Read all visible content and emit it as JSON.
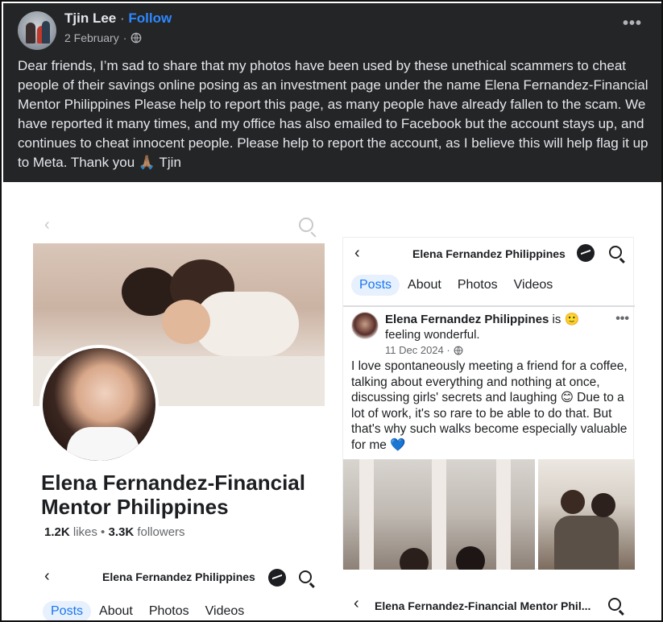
{
  "post": {
    "author": "Tjin Lee",
    "separator": "·",
    "follow_label": "Follow",
    "date": "2 February",
    "date_separator": "·",
    "audience_icon": "globe-icon",
    "more_label": "•••",
    "text": "Dear friends, I’m sad to share that my photos have been used by these unethical scammers to cheat people of their savings online posing as an investment page under the name Elena Fernandez-Financial Mentor Philippines  Please help to report this page, as many people have already fallen to the scam. We have reported it many times, and my office has also emailed to Facebook but the account stays up, and continues to cheat innocent people. Please help to report the account, as I believe this will help flag it up to Meta. Thank you 🙏🏽 Tjin"
  },
  "screenshot_left": {
    "page_name": "Elena Fernandez-Financial Mentor Philippines",
    "likes_count": "1.2K",
    "likes_label": "likes",
    "dot": "•",
    "followers_count": "3.3K",
    "followers_label": "followers"
  },
  "screenshot_bottom_left": {
    "title": "Elena Fernandez Philippines",
    "tabs": [
      "Posts",
      "About",
      "Photos",
      "Videos"
    ]
  },
  "screenshot_right": {
    "title": "Elena Fernandez Philippines",
    "tabs": [
      "Posts",
      "About",
      "Photos",
      "Videos"
    ],
    "post_author": "Elena Fernandez Philippines",
    "post_feeling": " is 🙂 feeling wonderful.",
    "post_date": "11 Dec 2024 ·",
    "post_more": "•••",
    "post_text": "I love spontaneously meeting a friend for a coffee, talking about everything and nothing at once, discussing girls' secrets and laughing 😊 Due to a lot of work, it's so rare to be able to do that. But that's why such walks become especially valuable for me 💙"
  },
  "screenshot_bottom_right": {
    "title": "Elena Fernandez-Financial Mentor Phil..."
  },
  "colors": {
    "header_bg": "#242526",
    "follow": "#2d88ff",
    "tab_active": "#1877f2"
  }
}
